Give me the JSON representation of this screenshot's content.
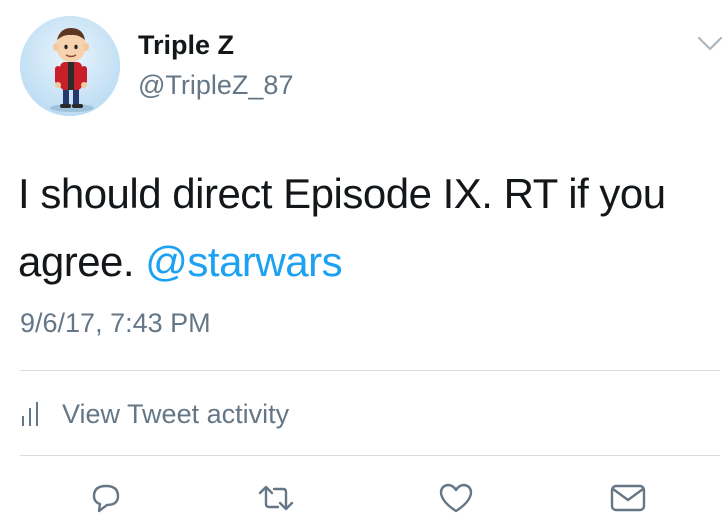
{
  "author": {
    "display_name": "Triple Z",
    "handle": "@TripleZ_87"
  },
  "tweet": {
    "text_before_mention": "I should direct Episode IX. RT if you agree. ",
    "mention": "@starwars",
    "timestamp": "9/6/17, 7:43 PM"
  },
  "activity": {
    "label": "View Tweet activity",
    "icon": "bar-chart-icon"
  },
  "actions": [
    {
      "name": "reply",
      "icon": "reply-icon"
    },
    {
      "name": "retweet",
      "icon": "retweet-icon"
    },
    {
      "name": "like",
      "icon": "heart-icon"
    },
    {
      "name": "message",
      "icon": "envelope-icon"
    }
  ],
  "colors": {
    "text": "#14171a",
    "secondary": "#657786",
    "link": "#1da1f2",
    "divider": "#d6dde3"
  }
}
